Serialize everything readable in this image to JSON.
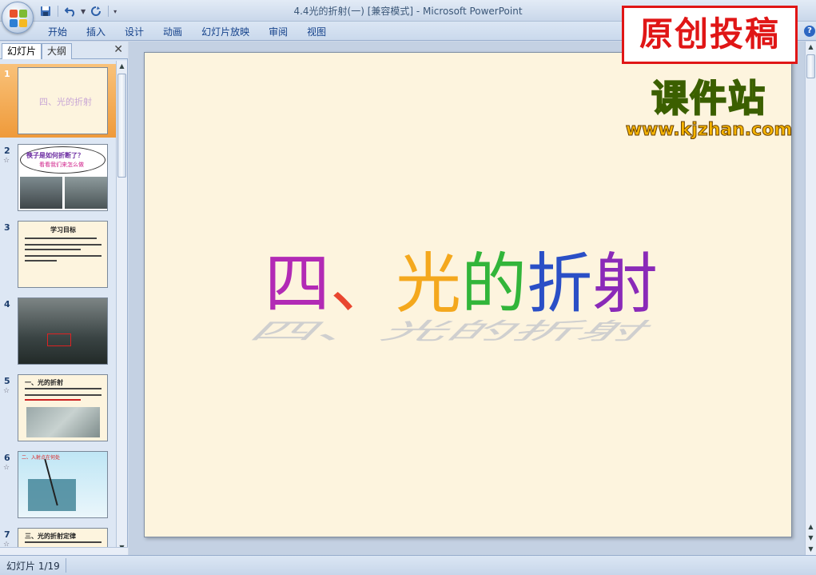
{
  "window": {
    "title": "4.4光的折射(一) [兼容模式] - Microsoft PowerPoint"
  },
  "quick_access": {
    "icons": [
      "save-icon",
      "undo-icon",
      "redo-icon",
      "customize-icon"
    ]
  },
  "ribbon": {
    "tabs": [
      "开始",
      "插入",
      "设计",
      "动画",
      "幻灯片放映",
      "审阅",
      "视图"
    ]
  },
  "left_pane": {
    "tabs": [
      "幻灯片",
      "大纲"
    ],
    "close_glyph": "✕",
    "thumbnails": [
      {
        "number": "1",
        "anim": "",
        "text": "四、光的折射",
        "selected": true
      },
      {
        "number": "2",
        "anim": "☆",
        "text": "筷子是如何折断了？",
        "sub": "看看我们来怎么做",
        "selected": false
      },
      {
        "number": "3",
        "anim": "",
        "text": "学习目标",
        "selected": false
      },
      {
        "number": "4",
        "anim": "",
        "text": "",
        "selected": false
      },
      {
        "number": "5",
        "anim": "☆",
        "text": "一、光的折射",
        "selected": false
      },
      {
        "number": "6",
        "anim": "☆",
        "text": "二、入射点在何处",
        "selected": false
      },
      {
        "number": "7",
        "anim": "☆",
        "text": "三、光的折射定律",
        "selected": false
      }
    ]
  },
  "slide": {
    "title_chars": [
      "四",
      "、",
      "光",
      "的",
      "折",
      "射"
    ],
    "title_colors": [
      "#b22ab5",
      "#e9462f",
      "#f4a81d",
      "#32b53a",
      "#2a4fc6",
      "#8a2ab8"
    ]
  },
  "watermarks": {
    "stamp": "原创投稿",
    "logo": "课件站",
    "url": "www.kjzhan.com"
  },
  "status": {
    "slide_info": "幻灯片 1/19"
  },
  "help_glyph": "?"
}
